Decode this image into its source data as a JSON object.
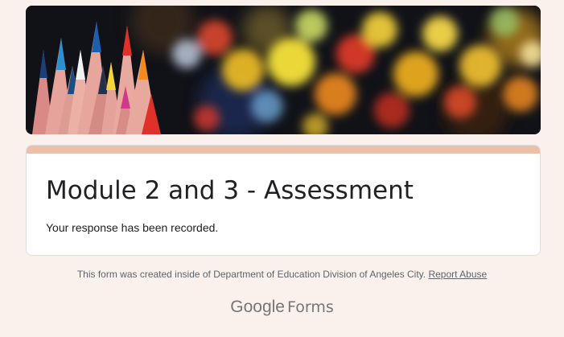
{
  "form": {
    "title": "Module 2 and 3 - Assessment",
    "confirmation": "Your response has been recorded."
  },
  "footer": {
    "created_text": "This form was created inside of Department of Education Division of Angeles City.",
    "report_abuse": "Report Abuse"
  },
  "logo": {
    "brand": "Google",
    "product": "Forms"
  },
  "theme": {
    "background": "#faf1ec",
    "accent": "#ebbfa8"
  },
  "banner": {
    "icon": "colored-pencils-bokeh-image"
  }
}
